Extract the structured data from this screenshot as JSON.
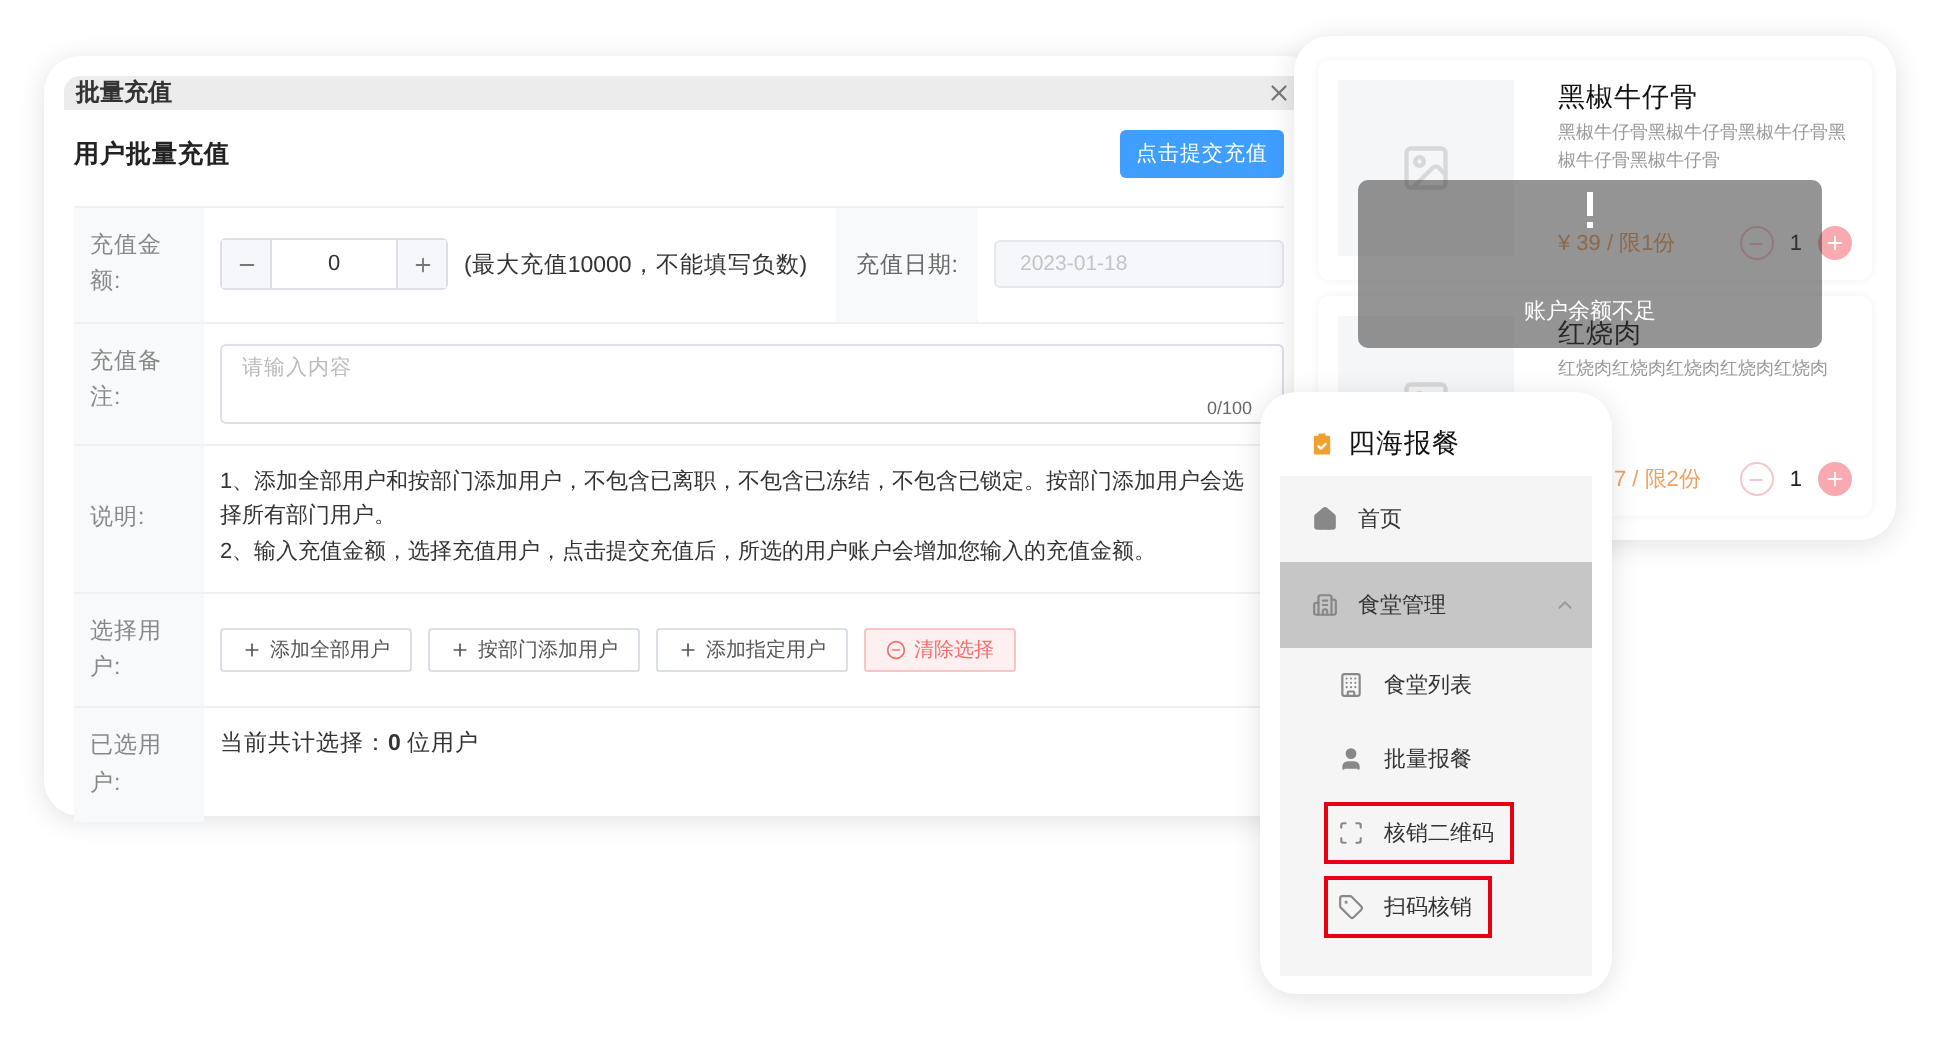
{
  "recharge_dialog": {
    "title": "批量充值",
    "heading": "用户批量充值",
    "submit_button": "点击提交充值",
    "amount": {
      "label": "充值金额:",
      "value": "0",
      "hint": "(最大充值10000，不能填写负数)"
    },
    "date": {
      "label": "充值日期:",
      "value": "2023-01-18",
      "disabled": true
    },
    "remark": {
      "label": "充值备注:",
      "placeholder": "请输入内容",
      "counter": "0/100"
    },
    "note": {
      "label": "说明:",
      "lines": [
        "1、添加全部用户和按部门添加用户，不包含已离职，不包含已冻结，不包含已锁定。按部门添加用户会选择所有部门用户。",
        "2、输入充值金额，选择充值用户，点击提交充值后，所选的用户账户会增加您输入的充值金额。"
      ]
    },
    "select_users": {
      "label": "选择用户:",
      "buttons": [
        {
          "kind": "add",
          "label": "添加全部用户"
        },
        {
          "kind": "add",
          "label": "按部门添加用户"
        },
        {
          "kind": "add",
          "label": "添加指定用户"
        },
        {
          "kind": "clear",
          "label": "清除选择"
        }
      ]
    },
    "selected_users": {
      "label": "已选用户:",
      "summary": "当前共计选择：**0** 位用户"
    }
  },
  "meal_list": {
    "items": [
      {
        "name": "黑椒牛仔骨",
        "description": "黑椒牛仔骨黑椒牛仔骨黑椒牛仔骨黑椒牛仔骨黑椒牛仔骨",
        "price": "¥ 39 / 限1份",
        "quantity": "1"
      },
      {
        "name": "红烧肉",
        "description": "红烧肉红烧肉红烧肉红烧肉红烧肉",
        "price": "7 / 限2份",
        "quantity": "1"
      }
    ]
  },
  "toast": {
    "message": "账户余额不足"
  },
  "menu": {
    "title": "四海报餐",
    "items": [
      {
        "label": "首页",
        "selected": false
      },
      {
        "label": "食堂管理",
        "selected": true,
        "expanded": true,
        "children": [
          {
            "label": "食堂列表",
            "highlighted": false
          },
          {
            "label": "批量报餐",
            "highlighted": false
          },
          {
            "label": "核销二维码",
            "highlighted": true
          },
          {
            "label": "扫码核销",
            "highlighted": true
          }
        ]
      }
    ]
  }
}
